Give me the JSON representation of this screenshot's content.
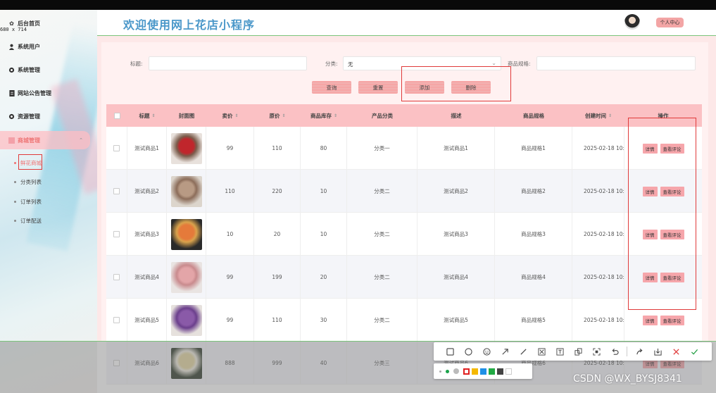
{
  "screen_dims": "680 x 714",
  "sidebar": {
    "home": {
      "icon": "gear-icon",
      "label": "后台首页"
    },
    "items": [
      {
        "icon": "user-icon",
        "label": "系统用户"
      },
      {
        "icon": "gear-icon",
        "label": "系统管理"
      },
      {
        "icon": "document-icon",
        "label": "网站公告管理"
      },
      {
        "icon": "gear-icon",
        "label": "资源管理"
      },
      {
        "icon": "grid-icon",
        "label": "商城管理",
        "expanded": true
      }
    ],
    "sub_items": [
      "鲜花商城",
      "分类列表",
      "订单列表",
      "订单配送"
    ],
    "active_sub": "鲜花商城"
  },
  "header": {
    "title": "欢迎使用网上花店小程序",
    "user_button": "个人中心"
  },
  "search": {
    "title_label": "标题:",
    "title_value": "",
    "category_label": "分类:",
    "category_value": "无",
    "spec_label": "商品规格:",
    "spec_value": ""
  },
  "buttons": {
    "query": "查询",
    "reset": "重置",
    "add": "添加",
    "delete": "删除"
  },
  "table": {
    "columns": [
      "标题",
      "封面图",
      "卖价",
      "原价",
      "商品库存",
      "产品分类",
      "描述",
      "商品规格",
      "创建时间",
      "操作"
    ],
    "rows": [
      {
        "title": "测试商品1",
        "price": "99",
        "orig": "110",
        "stock": "80",
        "cat": "分类一",
        "desc": "测试商品1",
        "spec": "商品规格1",
        "time": "2025-02-18 10:",
        "img": [
          "#e8e1dc",
          "#c0262c",
          "#7a5b4a"
        ]
      },
      {
        "title": "测试商品2",
        "price": "110",
        "orig": "220",
        "stock": "10",
        "cat": "分类二",
        "desc": "测试商品2",
        "spec": "商品规格2",
        "time": "2025-02-18 10:",
        "img": [
          "#dcd5cc",
          "#b89a84",
          "#8c6d5a"
        ]
      },
      {
        "title": "测试商品3",
        "price": "10",
        "orig": "20",
        "stock": "10",
        "cat": "分类二",
        "desc": "测试商品3",
        "spec": "商品规格3",
        "time": "2025-02-18 10:",
        "img": [
          "#2a2a2a",
          "#e57a3a",
          "#d9a24c"
        ]
      },
      {
        "title": "测试商品4",
        "price": "99",
        "orig": "199",
        "stock": "20",
        "cat": "分类二",
        "desc": "测试商品4",
        "spec": "商品规格4",
        "time": "2025-02-18 10:",
        "img": [
          "#e9e4e2",
          "#e3a5a8",
          "#c98b8e"
        ]
      },
      {
        "title": "测试商品5",
        "price": "99",
        "orig": "110",
        "stock": "30",
        "cat": "分类二",
        "desc": "测试商品5",
        "spec": "商品规格5",
        "time": "2025-02-18 10:",
        "img": [
          "#e6e1dd",
          "#8a5aa8",
          "#6b3f8c"
        ]
      },
      {
        "title": "测试商品6",
        "price": "888",
        "orig": "999",
        "stock": "40",
        "cat": "分类三",
        "desc": "测试商品6",
        "spec": "商品规格6",
        "time": "2025-02-18 10:",
        "img": [
          "#2e3a2a",
          "#e6d8a0",
          "#f0ece0"
        ]
      }
    ],
    "actions": [
      "详情",
      "查看评论"
    ]
  },
  "annot_toolbar": {
    "tools": [
      "rectangle-icon",
      "circle-icon",
      "emoji-icon",
      "arrow-icon",
      "line-icon",
      "mosaic-icon",
      "text-icon",
      "pin-icon",
      "ocr-icon",
      "undo-icon",
      "share-icon",
      "download-icon",
      "close-icon",
      "check-icon"
    ],
    "colors": [
      "#e02020",
      "#f5b800",
      "#1e90e6",
      "#22aa44",
      "#444444",
      "#ffffff"
    ]
  },
  "watermark": "CSDN @WX_BYSJ8341"
}
